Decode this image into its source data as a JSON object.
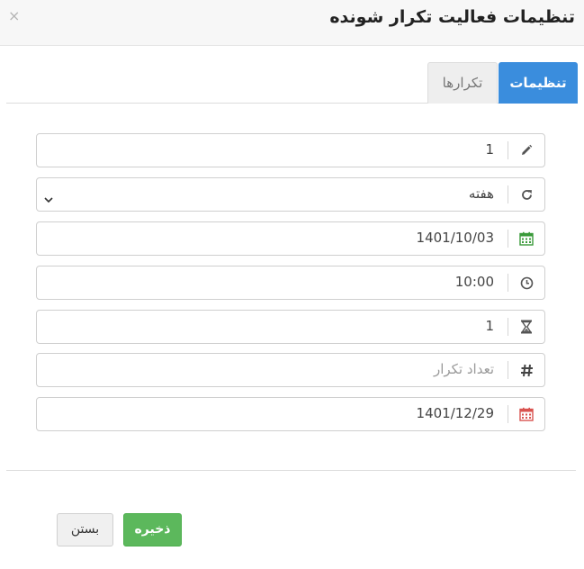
{
  "modal": {
    "title": "تنظیمات فعالیت تکرار شونده",
    "close_symbol": "×"
  },
  "tabs": [
    {
      "label": "تنظیمات",
      "active": true
    },
    {
      "label": "تکرارها",
      "active": false
    }
  ],
  "fields": {
    "count": {
      "value": "1",
      "icon": "pencil-icon"
    },
    "period": {
      "value": "هفته",
      "icon": "refresh-icon"
    },
    "start_date": {
      "value": "1401/10/03",
      "icon": "calendar-icon",
      "icon_color": "#3a9a3a"
    },
    "time": {
      "value": "10:00",
      "icon": "clock-icon"
    },
    "duration": {
      "value": "1",
      "icon": "hourglass-icon"
    },
    "repeat_count": {
      "value": "",
      "placeholder": "تعداد تکرار",
      "icon": "hash-icon"
    },
    "end_date": {
      "value": "1401/12/29",
      "icon": "calendar-icon",
      "icon_color": "#d9534f"
    }
  },
  "footer": {
    "save_label": "ذخیره",
    "close_label": "بستن"
  },
  "colors": {
    "accent": "#3a8ddd",
    "save": "#5cb85c"
  }
}
